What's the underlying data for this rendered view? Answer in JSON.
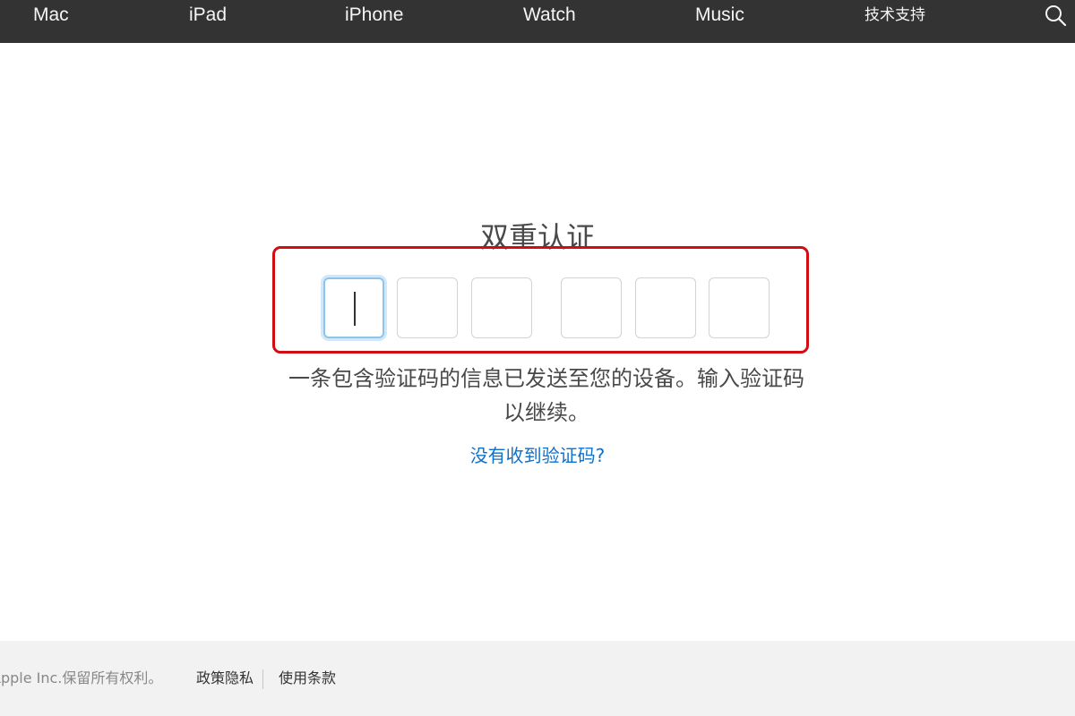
{
  "nav": {
    "items": [
      {
        "label": "Mac"
      },
      {
        "label": "iPad"
      },
      {
        "label": "iPhone"
      },
      {
        "label": "Watch"
      },
      {
        "label": "Music"
      },
      {
        "label": "技术支持"
      }
    ],
    "search_icon": "search-icon"
  },
  "main": {
    "title": "双重认证",
    "code_digits": [
      "",
      "",
      "",
      "",
      "",
      ""
    ],
    "message_line1": "一条包含验证码的信息已发送至您的设备。输入验证码",
    "message_line2": "以继续。",
    "resend_link": "没有收到验证码?"
  },
  "footer": {
    "copyright": "Apple Inc.保留所有权利。",
    "privacy_link": "政策隐私",
    "terms_link": "使用条款"
  },
  "colors": {
    "nav_background": "#333333",
    "highlight": "#d20d12",
    "link": "#1070c9",
    "footer_background": "#f2f2f2",
    "active_field": "#8ec4ec"
  }
}
